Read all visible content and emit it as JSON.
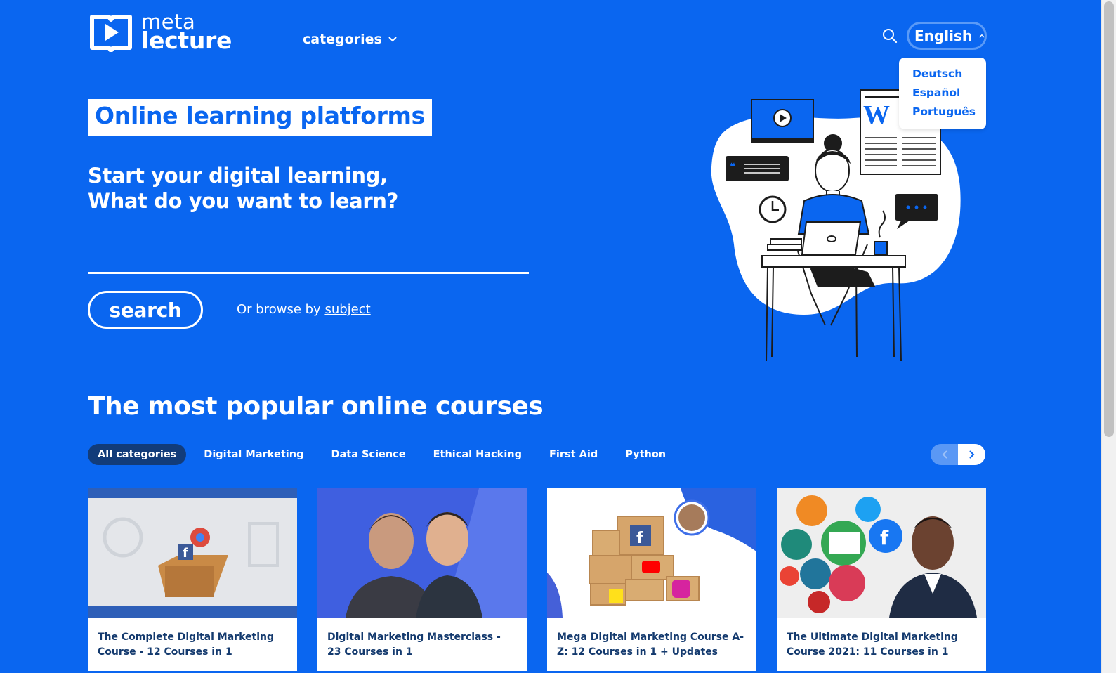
{
  "brand": {
    "line1": "meta",
    "line2": "lecture"
  },
  "nav": {
    "categories_label": "categories"
  },
  "language": {
    "current": "English",
    "options": [
      "Deutsch",
      "Español",
      "Português"
    ]
  },
  "hero": {
    "tagline": "Online learning platforms",
    "subtitle_line1": "Start your digital learning,",
    "subtitle_line2": "What do you want to learn?",
    "search_placeholder": "",
    "search_button": "search",
    "browse_prefix": "Or browse by ",
    "browse_link": "subject"
  },
  "popular": {
    "title": "The most popular online courses",
    "categories": [
      "All categories",
      "Digital Marketing",
      "Data Science",
      "Ethical Hacking",
      "First Aid",
      "Python"
    ],
    "active_category": "All categories"
  },
  "courses": [
    {
      "title": "The Complete Digital Marketing Course - 12 Courses in 1"
    },
    {
      "title": "Digital Marketing Masterclass - 23 Courses in 1"
    },
    {
      "title": "Mega Digital Marketing Course A-Z: 12 Courses in 1 + Updates"
    },
    {
      "title": "The Ultimate Digital Marketing Course 2021: 11 Courses in 1"
    }
  ],
  "colors": {
    "brand_blue": "#0a66f0",
    "dark_navy": "#123c7a",
    "title_navy": "#143a6e"
  },
  "icons": [
    "logo-play-book-icon",
    "chevron-down-icon",
    "search-icon",
    "chevron-up-icon",
    "chevron-left-icon",
    "chevron-right-icon"
  ]
}
